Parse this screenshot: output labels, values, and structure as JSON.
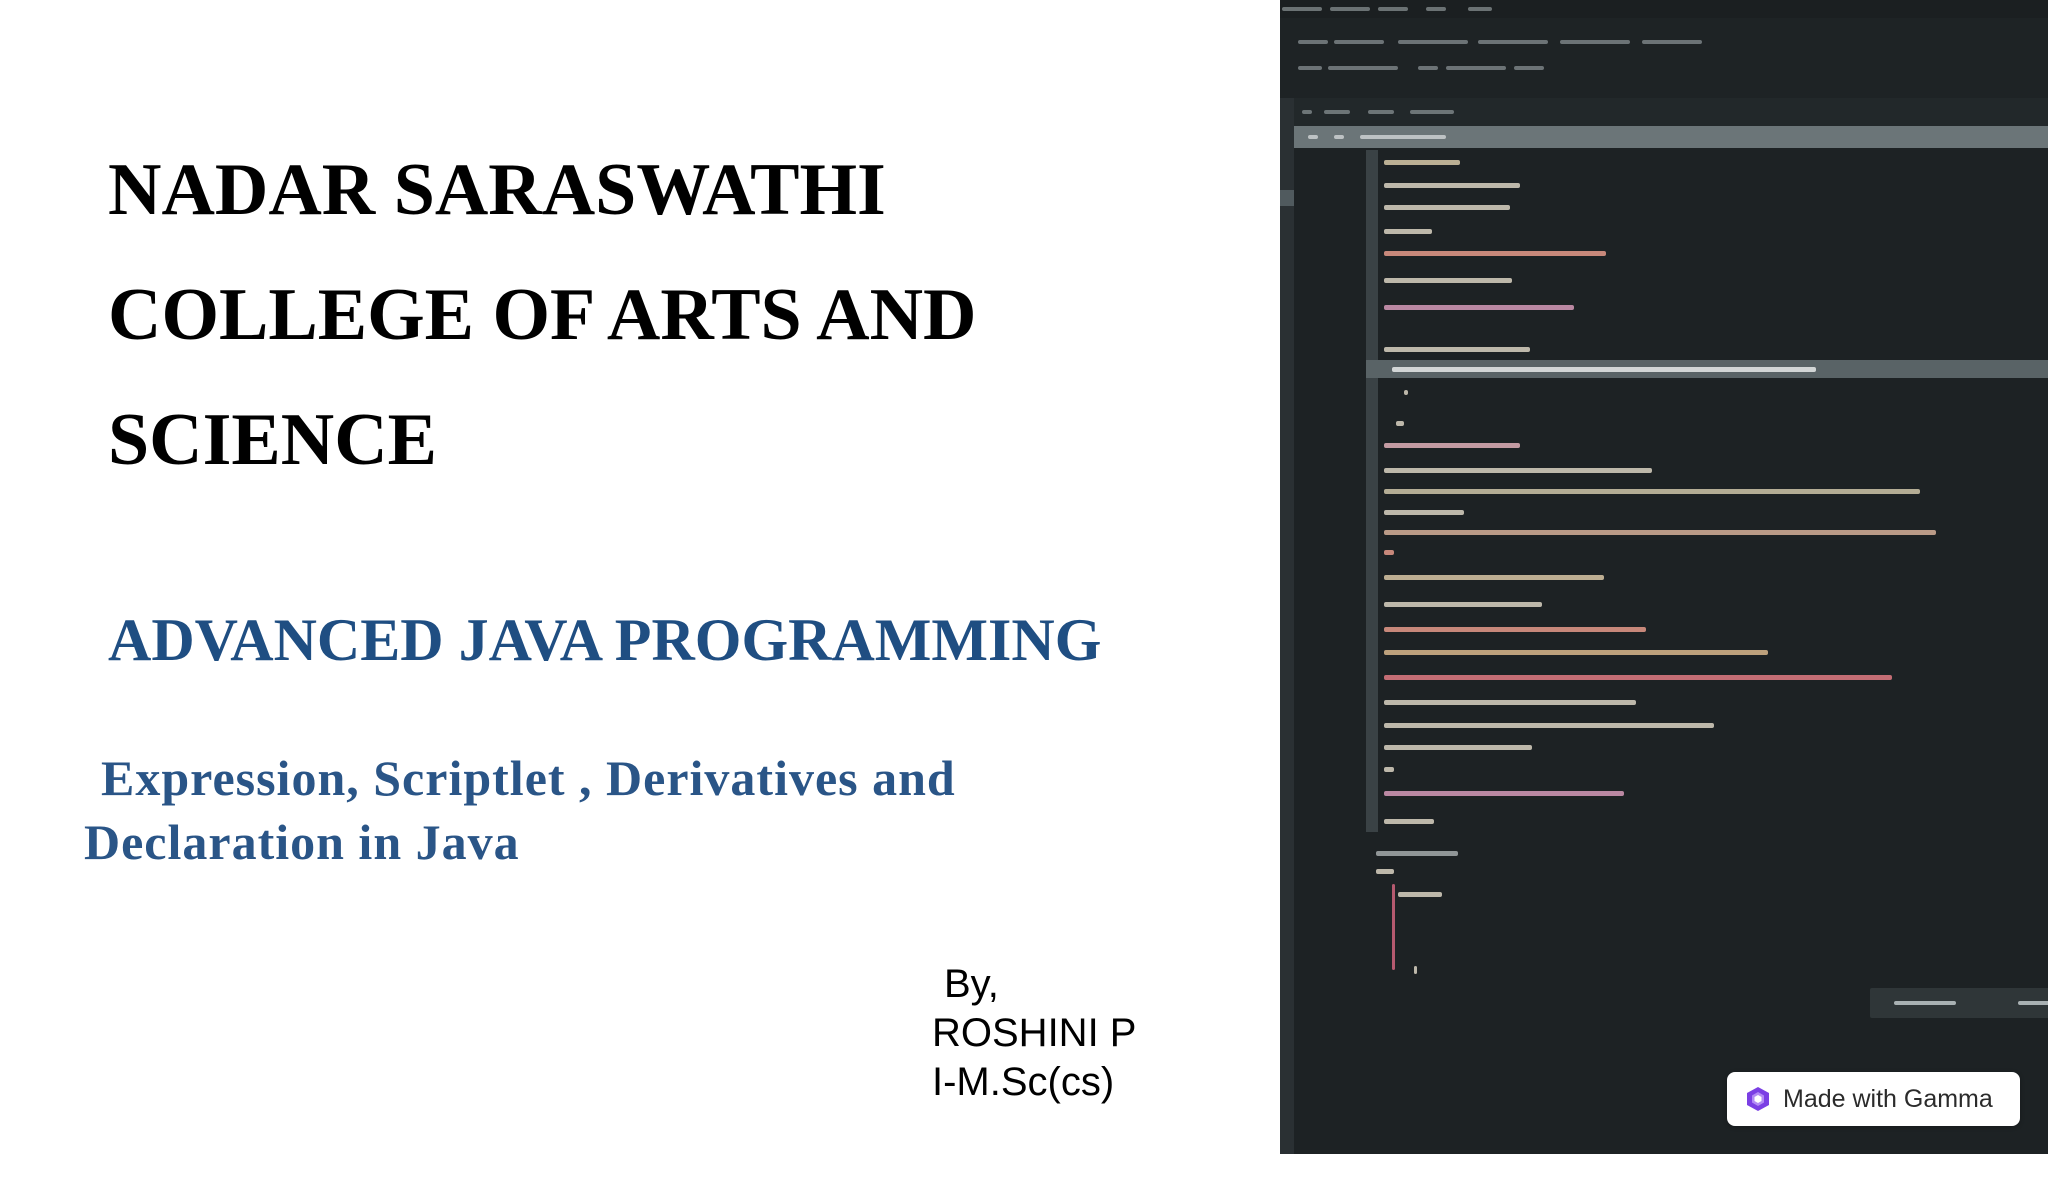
{
  "slide": {
    "college_title": "NADAR SARASWATHI\nCOLLEGE OF ARTS AND\nSCIENCE",
    "course_title": "ADVANCED JAVA PROGRAMMING",
    "topic_line1": "Expression, Scriptlet , Derivatives and",
    "topic_line2": "Declaration in Java",
    "author_by": "By,",
    "author_name": "ROSHINI P",
    "author_class": "I-M.Sc(cs)"
  },
  "badge": {
    "label": "Made with Gamma",
    "icon": "gamma-logo-icon"
  },
  "colors": {
    "heading": "#000000",
    "course": "#1f4e82",
    "topic": "#2a5587",
    "editor_bg": "#1d2224",
    "gamma_purple": "#7b3fe4"
  }
}
